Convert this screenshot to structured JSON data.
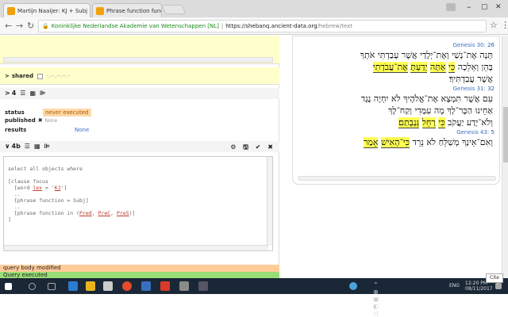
{
  "browser": {
    "tabs": [
      {
        "title": "Martijn Naaijer: KJ + Subj"
      },
      {
        "title": "Phrase function function"
      }
    ],
    "url": {
      "site": "Koninklijke Nederlandse Akademie van Wetenschappen [NL]",
      "host": "https://shebanq.ancient-data.org",
      "path": "/hebrew/text"
    },
    "window": {
      "minimize": "–",
      "restore": "▢",
      "close": "✕"
    }
  },
  "left": {
    "shared": {
      "label": "shared",
      "value": "-.--.--.--.-"
    },
    "results_header": {
      "count": "4"
    },
    "status": {
      "label": "status",
      "value": "never executed"
    },
    "published": {
      "label": "published",
      "value": "None"
    },
    "results": {
      "label": "results",
      "value": "None"
    },
    "query_header": {
      "count": "4b"
    },
    "code_lines": [
      "select all objects where",
      "",
      "[clause focus",
      "  [word lex = 'KJ']",
      "  ..",
      "  [phrase function = Subj]",
      "  ..",
      "  [phrase function in (Pred, PreC, PreS)]",
      "]"
    ],
    "messages": {
      "modified": "query body modified",
      "executed": "Query executed"
    }
  },
  "hebrew": {
    "refs": [
      {
        "book": "Genesis 30:",
        "verse": "26"
      },
      {
        "book": "Genesis 31:",
        "verse": "32"
      },
      {
        "book": "Genesis 43:",
        "verse": "5"
      }
    ],
    "lines": [
      "תְּנָה אֶת־נָשַׁי וְאֶת־יְלָדַי אֲשֶׁר עָבַדְתִּי אֹתְךָ",
      "בָּהֵן וְאֵלֵכָה כִּי אַתָּה יָדַעְתָּ אֶת־עֲבֹדָתִי",
      "אֲשֶׁר עֲבַדְתִּיךָ׃",
      "עִם אֲשֶׁר תִּמְצָא אֶת־אֱלֹהֶיךָ לֹא יִחְיֶה נֶגֶד",
      "אַחֵינוּ הַכֶּר־לְךָ מָה עִמָּדִי וְקַח־לָךְ",
      "וְלֹא־יָדַע יַעֲקֹב כִּי רָחֵל גְּנָבָתַם׃",
      "וְאִם־אֵינְךָ מְשַׁלֵּחַ לֹא נֵרֵד כִּי־הָאִישׁ אָמַר"
    ],
    "highlights": [
      "כִּי",
      "אַתָּה",
      "יָדַעְתָּ",
      "אֶת־עֲבֹדָתִי",
      "רָחֵל",
      "גְּנָבָתַם׃",
      "כִּי־הָאִישׁ",
      "אָמַר"
    ]
  },
  "taskbar": {
    "lang": "ENG",
    "time": "12:20 PM",
    "date": "08/11/2017"
  },
  "colors": {
    "yellow_panel": "#ffffcc",
    "modified_bg": "#ffcc99",
    "executed_bg": "#99dd77",
    "accent_blue": "#3b6fc1"
  }
}
